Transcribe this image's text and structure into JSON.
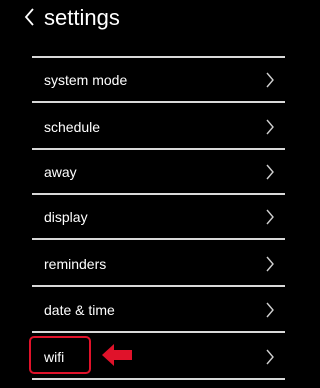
{
  "header": {
    "back_icon": "chevron-left-icon",
    "title": "settings"
  },
  "menu": {
    "items": [
      {
        "label": "system mode"
      },
      {
        "label": "schedule"
      },
      {
        "label": "away"
      },
      {
        "label": "display"
      },
      {
        "label": "reminders"
      },
      {
        "label": "date & time"
      },
      {
        "label": "wifi"
      }
    ],
    "chevron_icon": "chevron-right-icon"
  },
  "annotation": {
    "highlight_color": "#e0122a",
    "arrow_icon": "left-arrow-icon"
  }
}
